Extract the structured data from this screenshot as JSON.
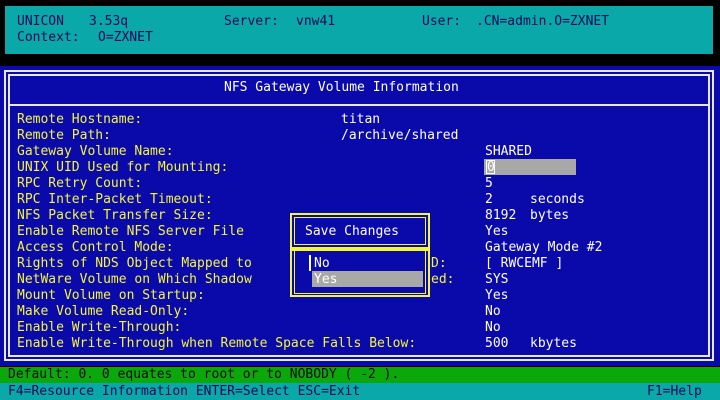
{
  "header": {
    "app": "UNICON",
    "version": "3.53q",
    "server_label": "Server:",
    "server": "vnw41",
    "user_label": "User:",
    "user": ".CN=admin.O=ZXNET",
    "context_label": "Context:",
    "context": "O=ZXNET"
  },
  "panel": {
    "title": "NFS Gateway Volume Information"
  },
  "fields": [
    {
      "label": "Remote Hostname:",
      "value": "titan"
    },
    {
      "label": "Remote Path:",
      "value": "/archive/shared"
    },
    {
      "label": "Gateway Volume Name:",
      "value": "SHARED"
    },
    {
      "label": "UNIX UID Used for Mounting:",
      "value": "0"
    },
    {
      "label": "RPC Retry Count:",
      "value": "5"
    },
    {
      "label": "RPC Inter-Packet Timeout:",
      "value": "2",
      "unit": "seconds"
    },
    {
      "label": "NFS Packet Transfer Size:",
      "value": "8192",
      "unit": "bytes"
    },
    {
      "label": "Enable Remote NFS Server File",
      "value": "Yes"
    },
    {
      "label": "Access Control Mode:",
      "value": "Gateway Mode #2"
    },
    {
      "label": "Rights of NDS Object Mapped to",
      "label_tail": "D:",
      "value": "[ RWCEMF ]"
    },
    {
      "label": "NetWare Volume on Which Shadow",
      "label_tail": "ed:",
      "value": "SYS"
    },
    {
      "label": "Mount Volume on Startup:",
      "value": "Yes"
    },
    {
      "label": "Make Volume Read-Only:",
      "value": "No"
    },
    {
      "label": "Enable Write-Through:",
      "value": "No"
    },
    {
      "label": "Enable Write-Through when Remote Space Falls Below:",
      "value": "500",
      "unit": "kbytes"
    }
  ],
  "popup": {
    "title": "Save Changes",
    "options": [
      "No",
      "Yes"
    ],
    "selected": "Yes"
  },
  "status": {
    "text": "Default: 0. 0 equates to root or to NOBODY ( -2 )."
  },
  "function_bar": {
    "left": "F4=Resource Information ENTER=Select ESC=Exit",
    "right": "F1=Help"
  },
  "colors": {
    "panel_bg": "#0a0aaa",
    "header_bg": "#0aa8a8",
    "label": "#f5f53c",
    "value": "#ffffff",
    "status_bg": "#0aa80a"
  }
}
